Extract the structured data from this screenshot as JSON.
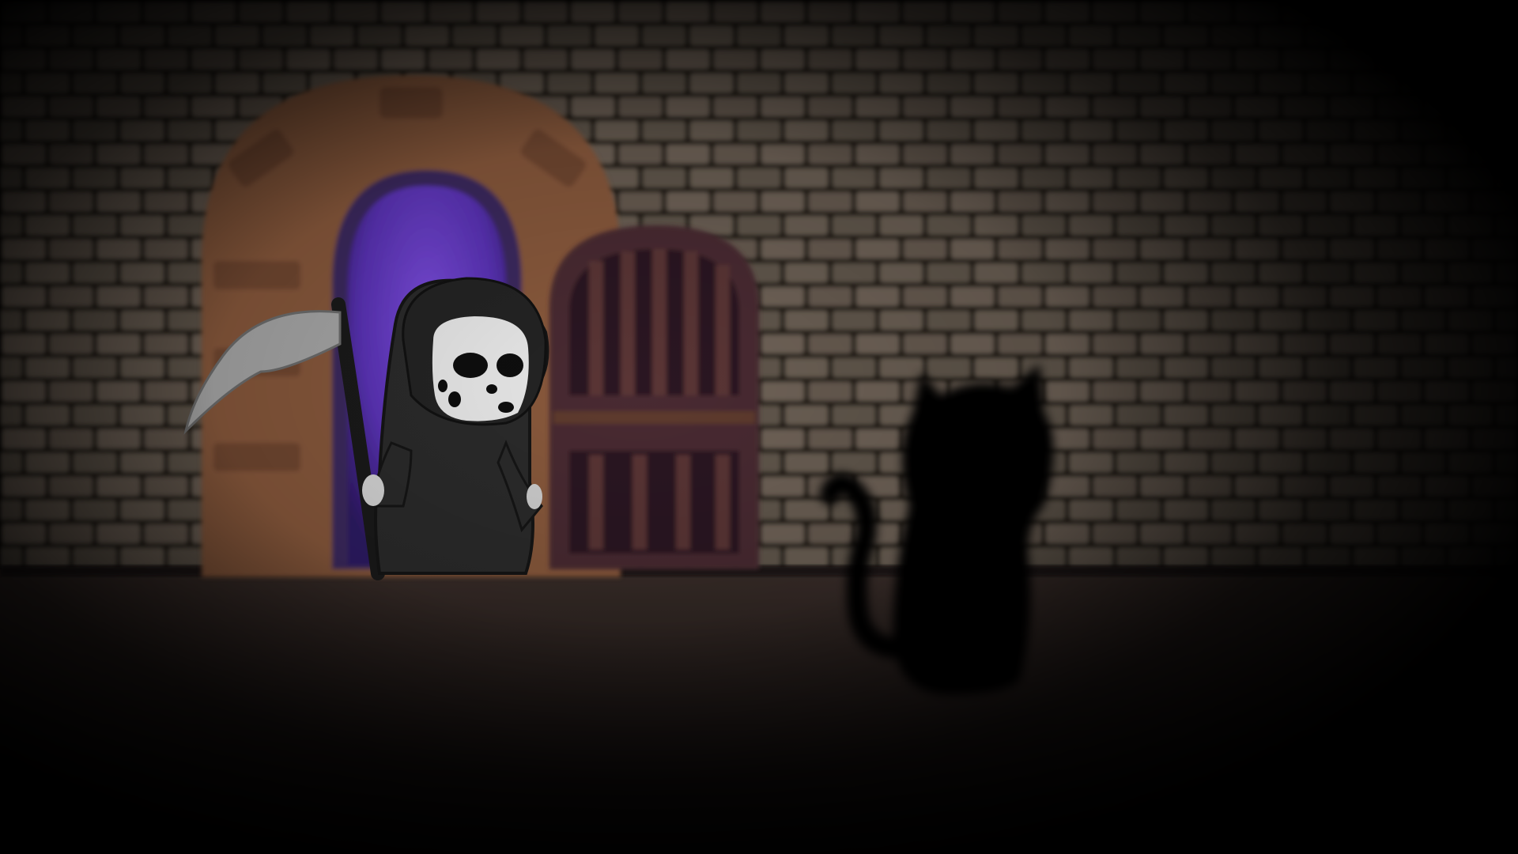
{
  "scene": {
    "setting": "dungeon-room",
    "lighting": "dim-spotlight-left"
  },
  "colors": {
    "wall_brick": "#6f6458",
    "wall_mortar": "#231d19",
    "arch_stone": "#8a5a3c",
    "portal_glow": "#5b33b8",
    "door_wood": "#4a2a30",
    "floor": "#2a2120",
    "reaper_robe": "#2b2b2b",
    "skull": "#e9e9e9",
    "scythe_blade": "#a9a9a9",
    "cat_silhouette": "#050505"
  },
  "characters": {
    "reaper": {
      "icon": "grim-reaper-icon"
    },
    "cat": {
      "icon": "black-cat-silhouette-icon"
    }
  }
}
